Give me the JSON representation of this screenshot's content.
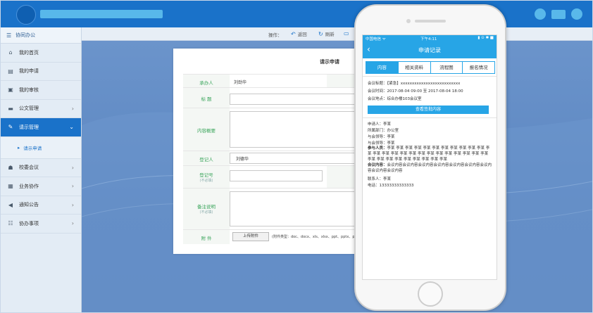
{
  "sidebar": {
    "header": "协同办公",
    "items": [
      {
        "label": "我的首页",
        "icon": "home-icon",
        "chevron": false
      },
      {
        "label": "我的申请",
        "icon": "list-icon",
        "chevron": false
      },
      {
        "label": "我的审核",
        "icon": "book-icon",
        "chevron": false
      },
      {
        "label": "公文管理",
        "icon": "folder-icon",
        "chevron": true
      },
      {
        "label": "请示管理",
        "icon": "edit-icon",
        "chevron": true,
        "active": true
      },
      {
        "label": "校委会议",
        "icon": "meeting-icon",
        "chevron": true
      },
      {
        "label": "业务协作",
        "icon": "briefcase-icon",
        "chevron": true
      },
      {
        "label": "通知公告",
        "icon": "speaker-icon",
        "chevron": true
      },
      {
        "label": "协办事项",
        "icon": "tasks-icon",
        "chevron": true
      }
    ],
    "sub_item": "请示申请"
  },
  "toolbar": {
    "label": "操作：",
    "back": "返回",
    "refresh": "刷新"
  },
  "form": {
    "title": "请示申请",
    "rows": {
      "applicant": {
        "label": "承办人",
        "value": "刘劲华"
      },
      "subject": {
        "label": "标 题"
      },
      "content": {
        "label": "内容概要"
      },
      "register": {
        "label": "登记人",
        "value": "刘德华"
      },
      "reg_no": {
        "label": "登记号",
        "hint": "(不必填)"
      },
      "opinion": {
        "label": "备注说明",
        "hint": "(不必填)"
      },
      "attach": {
        "label": "附 件",
        "button": "上传附件",
        "note": "(附件类型：doc、docx、xls、xlsx、ppt、pptx、pdf"
      }
    }
  },
  "phone": {
    "status": {
      "carrier": "中国电信 ᯤ",
      "time": "下午4:11",
      "right": "▮ ⊙ ✱ ■"
    },
    "nav_title": "申请记录",
    "tabs": [
      {
        "label": "内容",
        "active": true
      },
      {
        "label": "相关资料"
      },
      {
        "label": "流程图"
      },
      {
        "label": "报名情况"
      }
    ],
    "meeting_title": "会议标题：【紧急】xxxxxxxxxxxxxxxxxxxxxxxxxx",
    "meeting_time": "会议时间：2017-08-04 09:00   至   2017-08-04 18:00",
    "meeting_place": "会议地点：综合办楼103会议室",
    "view_button": "查看签批内容",
    "applicant": "申请人：李某",
    "department": "所属部门：办公室",
    "leader": "与会领导：李某",
    "leader2": "与会领导：李某",
    "participants_key": "参与人员：",
    "participants": "李某  李某  李某  李某  李某  李某  李某  李某  李某  李某  李某  李某  李某  李某  李某  李某  李某  李某  李某  李某  李某  李某  李某  李某  李某  李某  李某  李某  李某  李某  李某  李某  李某  李某",
    "content_key": "会议内容：",
    "content": "会议内容会议内容会议内容会议内容会议内容会议内容会议内容会议内容会议内容",
    "contact": "联系人：李某",
    "phone": "电话：13333333333333"
  }
}
